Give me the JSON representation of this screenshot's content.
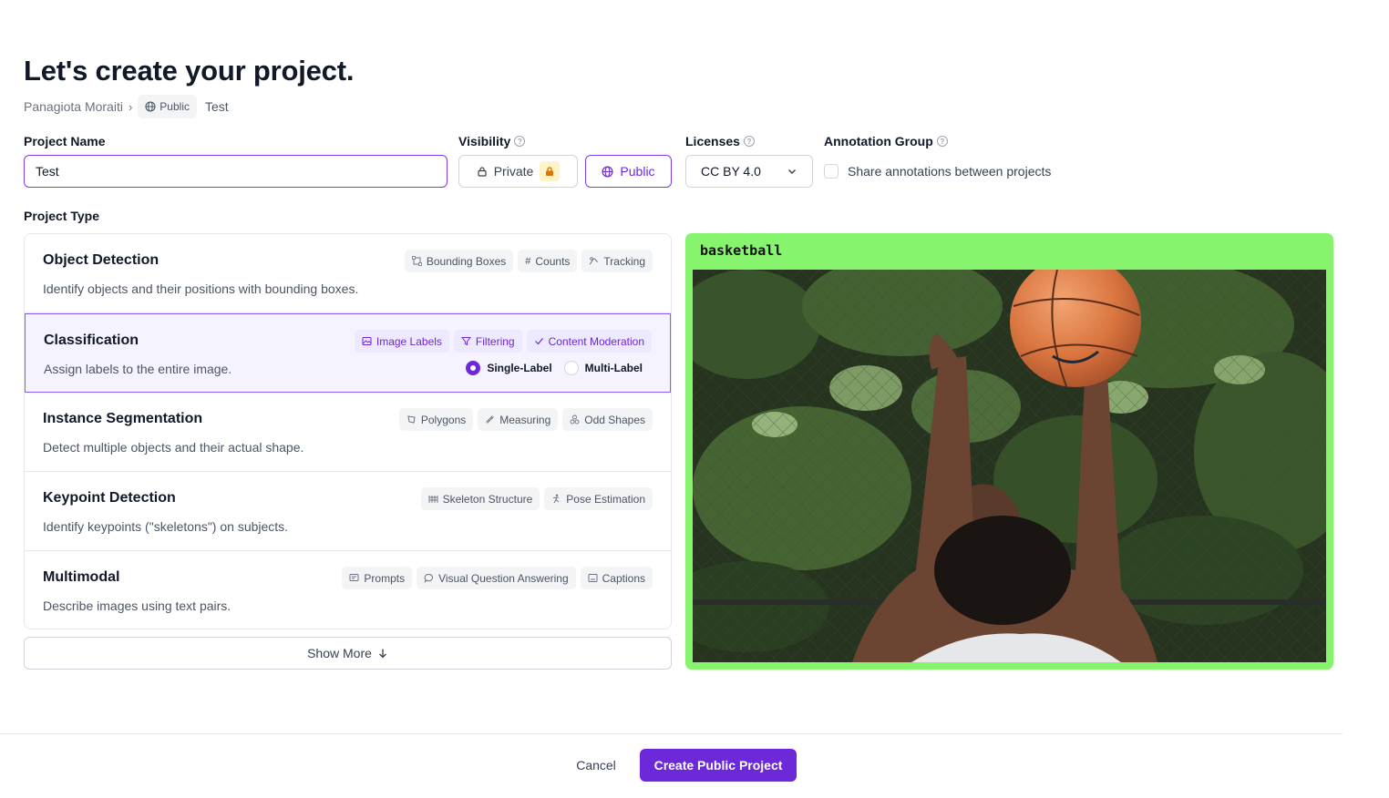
{
  "page": {
    "title": "Let's create your project.",
    "breadcrumb": {
      "owner": "Panagiota Moraiti",
      "visibility": "Public",
      "project": "Test"
    }
  },
  "form": {
    "project_name_label": "Project Name",
    "project_name_value": "Test",
    "visibility_label": "Visibility",
    "visibility_options": {
      "private": "Private",
      "public": "Public"
    },
    "visibility_selected": "Public",
    "licenses_label": "Licenses",
    "license_value": "CC BY 4.0",
    "annotation_group_label": "Annotation Group",
    "share_annotations_label": "Share annotations between projects",
    "share_annotations_checked": false,
    "project_type_label": "Project Type"
  },
  "project_types": [
    {
      "title": "Object Detection",
      "description": "Identify objects and their positions with bounding boxes.",
      "tags": [
        {
          "label": "Bounding Boxes",
          "icon": "bounding-box-icon"
        },
        {
          "label": "Counts",
          "icon": "hash-icon"
        },
        {
          "label": "Tracking",
          "icon": "tracking-icon"
        }
      ]
    },
    {
      "title": "Classification",
      "description": "Assign labels to the entire image.",
      "selected": true,
      "tags": [
        {
          "label": "Image Labels",
          "icon": "image-icon"
        },
        {
          "label": "Filtering",
          "icon": "filter-icon"
        },
        {
          "label": "Content Moderation",
          "icon": "check-icon"
        }
      ],
      "options": {
        "single": "Single-Label",
        "multi": "Multi-Label",
        "selected": "Single-Label"
      }
    },
    {
      "title": "Instance Segmentation",
      "description": "Detect multiple objects and their actual shape.",
      "tags": [
        {
          "label": "Polygons",
          "icon": "polygon-icon"
        },
        {
          "label": "Measuring",
          "icon": "ruler-icon"
        },
        {
          "label": "Odd Shapes",
          "icon": "shapes-icon"
        }
      ]
    },
    {
      "title": "Keypoint Detection",
      "description": "Identify keypoints (\"skeletons\") on subjects.",
      "tags": [
        {
          "label": "Skeleton Structure",
          "icon": "skeleton-icon"
        },
        {
          "label": "Pose Estimation",
          "icon": "pose-icon"
        }
      ]
    },
    {
      "title": "Multimodal",
      "description": "Describe images using text pairs.",
      "tags": [
        {
          "label": "Prompts",
          "icon": "prompt-icon"
        },
        {
          "label": "Visual Question Answering",
          "icon": "chat-icon"
        },
        {
          "label": "Captions",
          "icon": "caption-icon"
        }
      ]
    }
  ],
  "show_more_label": "Show More",
  "preview": {
    "label": "basketball",
    "border_color": "#86f46d"
  },
  "footer": {
    "cancel_label": "Cancel",
    "create_label": "Create Public Project"
  },
  "colors": {
    "accent": "#6d28d9",
    "selected_bg": "#f5f3ff"
  }
}
